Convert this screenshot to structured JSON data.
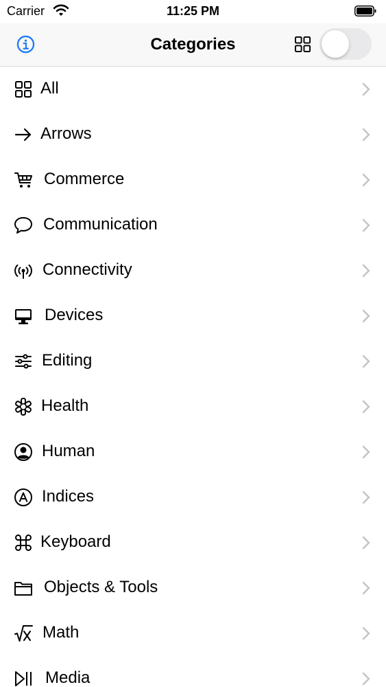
{
  "status_bar": {
    "carrier": "Carrier",
    "time": "11:25 PM"
  },
  "nav": {
    "title": "Categories",
    "info_icon": "info-circle-icon",
    "grid_icon": "grid-icon",
    "toggle_on": false
  },
  "colors": {
    "accent": "#1a7cf4",
    "chevron": "#c4c4c6",
    "separator": "#d6d6d8"
  },
  "categories": [
    {
      "label": "All",
      "icon": "grid-icon"
    },
    {
      "label": "Arrows",
      "icon": "arrow-right-icon"
    },
    {
      "label": "Commerce",
      "icon": "cart-icon"
    },
    {
      "label": "Communication",
      "icon": "speech-bubble-icon"
    },
    {
      "label": "Connectivity",
      "icon": "antenna-icon"
    },
    {
      "label": "Devices",
      "icon": "desktop-icon"
    },
    {
      "label": "Editing",
      "icon": "sliders-icon"
    },
    {
      "label": "Health",
      "icon": "staroflife-icon"
    },
    {
      "label": "Human",
      "icon": "person-circle-icon"
    },
    {
      "label": "Indices",
      "icon": "a-circle-icon"
    },
    {
      "label": "Keyboard",
      "icon": "command-icon"
    },
    {
      "label": "Objects & Tools",
      "icon": "folder-icon"
    },
    {
      "label": "Math",
      "icon": "square-root-icon"
    },
    {
      "label": "Media",
      "icon": "play-pause-icon"
    }
  ]
}
